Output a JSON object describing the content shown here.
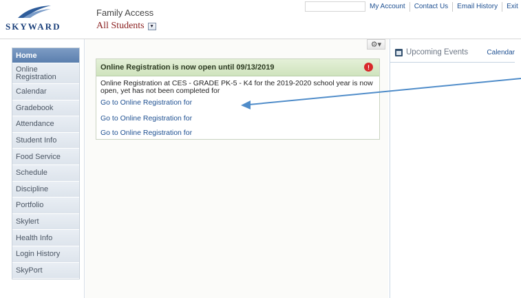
{
  "header": {
    "logo_text": "SKYWARD",
    "app_title": "Family Access",
    "student_selector": "All Students",
    "top_links": [
      "My Account",
      "Contact Us",
      "Email History",
      "Exit"
    ]
  },
  "nav": {
    "items": [
      {
        "label": "Home",
        "active": true
      },
      {
        "label": "Online Registration"
      },
      {
        "label": "Calendar"
      },
      {
        "label": "Gradebook"
      },
      {
        "label": "Attendance"
      },
      {
        "label": "Student Info"
      },
      {
        "label": "Food Service"
      },
      {
        "label": "Schedule"
      },
      {
        "label": "Discipline"
      },
      {
        "label": "Portfolio"
      },
      {
        "label": "Skylert"
      },
      {
        "label": "Health Info"
      },
      {
        "label": "Login History"
      },
      {
        "label": "SkyPort"
      }
    ]
  },
  "main": {
    "panel": {
      "title": "Online Registration is now open until 09/13/2019",
      "message": "Online Registration at CES - GRADE PK-5 - K4 for the 2019-2020 school year is now open, yet has not been completed for",
      "links": [
        "Go to Online Registration for",
        "Go to Online Registration for",
        "Go to Online Registration for"
      ]
    }
  },
  "right": {
    "events_title": "Upcoming Events",
    "calendar_link": "Calendar"
  },
  "colors": {
    "accent_blue": "#1d4f91",
    "active_nav": "#5b7fae",
    "panel_header": "#cfe3bd",
    "alert": "#d8282b",
    "annotation_arrow": "#4f8cc9"
  },
  "icons": [
    "gear-icon",
    "calendar-icon",
    "alert-icon",
    "dropdown-icon"
  ]
}
